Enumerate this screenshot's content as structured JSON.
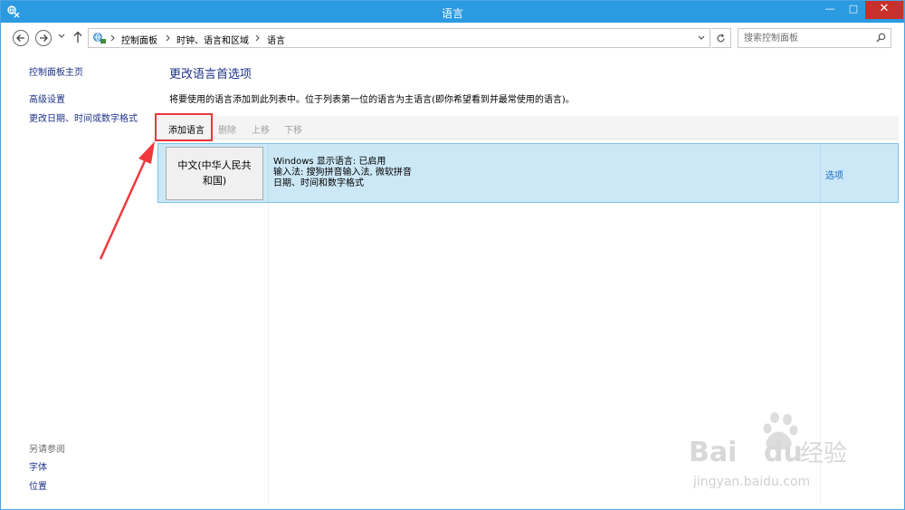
{
  "window": {
    "title": "语言",
    "minimize_label": "—",
    "maximize_label": "□",
    "close_label": "✕"
  },
  "nav": {
    "breadcrumbs": [
      "控制面板",
      "时钟、语言和区域",
      "语言"
    ],
    "search_placeholder": "搜索控制面板"
  },
  "sidebar": {
    "links": [
      "控制面板主页",
      "高级设置",
      "更改日期、时间或数字格式"
    ],
    "see_also_heading": "另请参阅",
    "see_also_links": [
      "字体",
      "位置"
    ]
  },
  "main": {
    "title": "更改语言首选项",
    "description": "将要使用的语言添加到此列表中。位于列表第一位的语言为主语言(即你希望看到并最常使用的语言)。",
    "toolbar": {
      "add_label": "添加语言",
      "remove_label": "删除",
      "move_up_label": "上移",
      "move_down_label": "下移"
    },
    "languages": [
      {
        "name_line1": "中文(中华人民共",
        "name_line2": "和国)",
        "info_line1": "Windows 显示语言: 已启用",
        "info_line2": "输入法: 搜狗拼音输入法, 微软拼音",
        "info_line3": "日期、时间和数字格式",
        "options_label": "选项"
      }
    ]
  },
  "watermark": {
    "brand": "Bai",
    "brand2": "du",
    "brand_cn": "经验",
    "url": "jingyan.baidu.com"
  },
  "colors": {
    "title_bar": "#2b9ae0",
    "close_button": "#c7302b",
    "link": "#1e3287",
    "selected_row": "#cce8f6",
    "highlight_annotation": "#e8363c"
  }
}
